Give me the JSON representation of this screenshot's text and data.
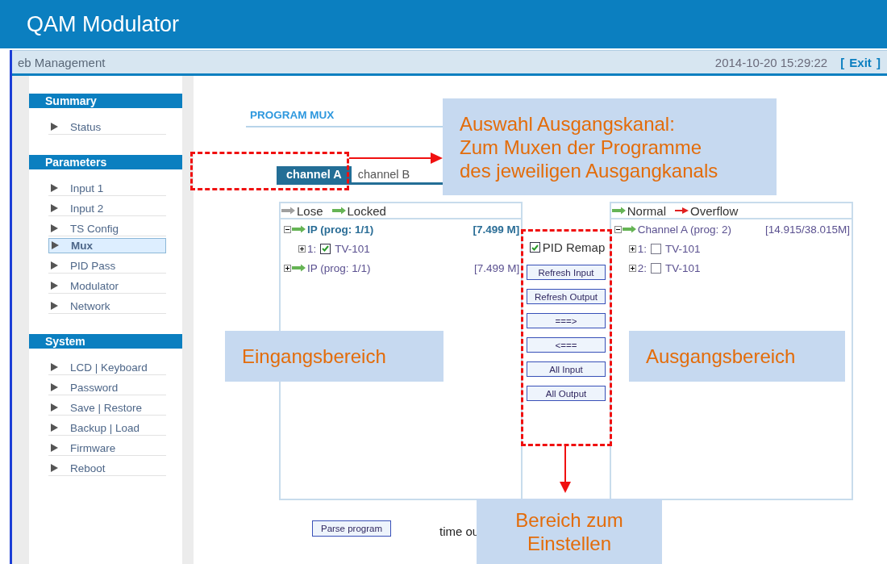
{
  "header": {
    "title": "QAM Modulator",
    "subtitle": "eb Management",
    "datetime": "2014-10-20 15:29:22",
    "exit": {
      "open": "[",
      "label": "Exit",
      "close": "]"
    }
  },
  "sidebar": {
    "sections": [
      {
        "title": "Summary",
        "items": [
          {
            "label": "Status",
            "selected": false
          }
        ]
      },
      {
        "title": "Parameters",
        "items": [
          {
            "label": "Input 1",
            "selected": false
          },
          {
            "label": "Input 2",
            "selected": false
          },
          {
            "label": "TS Config",
            "selected": false
          },
          {
            "label": "Mux",
            "selected": true
          },
          {
            "label": "PID Pass",
            "selected": false
          },
          {
            "label": "Modulator",
            "selected": false
          },
          {
            "label": "Network",
            "selected": false
          }
        ]
      },
      {
        "title": "System",
        "items": [
          {
            "label": "LCD | Keyboard",
            "selected": false
          },
          {
            "label": "Password",
            "selected": false
          },
          {
            "label": "Save | Restore",
            "selected": false
          },
          {
            "label": "Backup | Load",
            "selected": false
          },
          {
            "label": "Firmware",
            "selected": false
          },
          {
            "label": "Reboot",
            "selected": false
          }
        ]
      }
    ]
  },
  "content": {
    "title": "PROGRAM MUX",
    "tabs": [
      {
        "label": "channel A",
        "selected": true
      },
      {
        "label": "channel B",
        "selected": false
      }
    ],
    "input_panel": {
      "legend": [
        {
          "label": "Lose",
          "color": "#a0a0a0"
        },
        {
          "label": "Locked",
          "color": "#66b455"
        }
      ],
      "tree": [
        {
          "label": "IP (prog: 1/1)",
          "rate": "[7.499 M]",
          "selected": true,
          "expanded": true,
          "children": [
            {
              "index": "1:",
              "name": "TV-101",
              "checked": true
            }
          ]
        },
        {
          "label": "IP (prog: 1/1)",
          "rate": "[7.499 M]",
          "selected": false,
          "expanded": false
        }
      ]
    },
    "controls": {
      "pid_remap": {
        "label": "PID Remap",
        "checked": true
      },
      "buttons": [
        "Refresh Input",
        "Refresh Output",
        "===>",
        "<===",
        "All Input",
        "All Output"
      ]
    },
    "output_panel": {
      "legend": [
        {
          "label": "Normal",
          "color": "#66b455"
        },
        {
          "label": "Overflow",
          "color": "#e02020"
        }
      ],
      "tree": [
        {
          "label": "Channel A (prog: 2)",
          "rate": "[14.915/38.015M]",
          "selected": false,
          "expanded": true,
          "children": [
            {
              "index": "1:",
              "name": "TV-101",
              "checked": false
            },
            {
              "index": "2:",
              "name": "TV-101",
              "checked": false
            }
          ]
        }
      ]
    },
    "footer": {
      "parse_button": "Parse program",
      "timeout_text": "time ou"
    }
  },
  "annotations": [
    {
      "kind": "callout",
      "lines": [
        "Auswahl Ausgangskanal:",
        "Zum Muxen der Programme",
        "des jeweiligen Ausgangkanals"
      ]
    },
    {
      "kind": "callout",
      "lines": [
        "Eingangsbereich"
      ]
    },
    {
      "kind": "callout",
      "lines": [
        "Ausgangsbereich"
      ]
    },
    {
      "kind": "callout",
      "lines": [
        "Bereich zum",
        "Einstellen"
      ]
    }
  ]
}
